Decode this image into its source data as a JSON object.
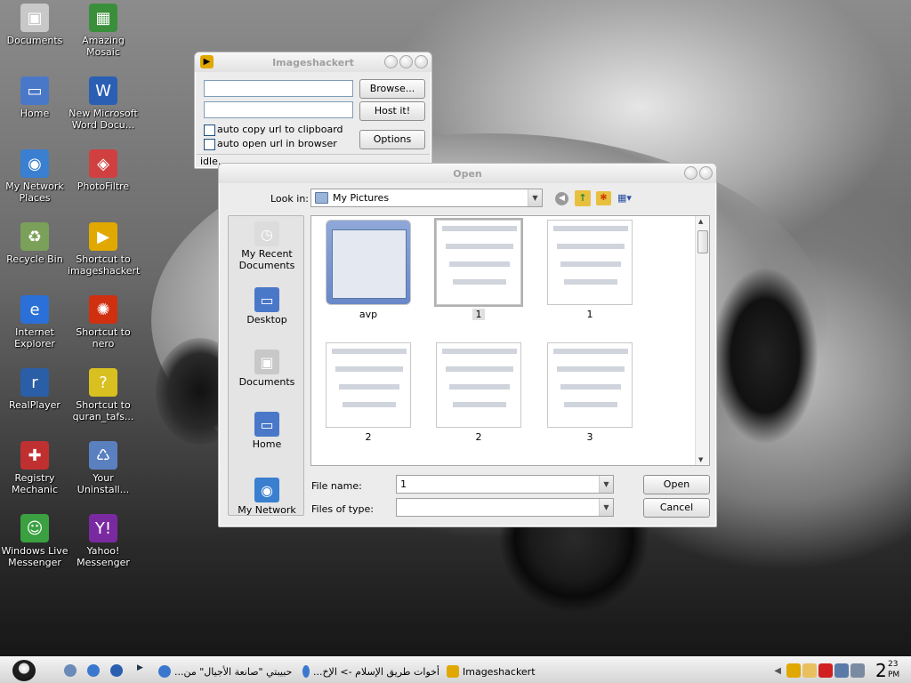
{
  "desktop": {
    "icons": [
      {
        "label": "Documents",
        "icon": "documents-folder-icon",
        "color": "#c8c8c8"
      },
      {
        "label": "Amazing Mosaic",
        "icon": "mosaic-icon",
        "color": "#3a8f3a"
      },
      {
        "label": "Home",
        "icon": "monitor-icon",
        "color": "#4a78c8"
      },
      {
        "label": "New Microsoft Word Docu...",
        "icon": "word-document-icon",
        "color": "#2b5fb4"
      },
      {
        "label": "My Network Places",
        "icon": "network-icon",
        "color": "#3a7fd0"
      },
      {
        "label": "PhotoFiltre",
        "icon": "photofiltre-icon",
        "color": "#d04040"
      },
      {
        "label": "Recycle Bin",
        "icon": "recycle-bin-icon",
        "color": "#7aa05a"
      },
      {
        "label": "Shortcut to imageshackert",
        "icon": "imageshack-icon",
        "color": "#e0a800"
      },
      {
        "label": "Internet Explorer",
        "icon": "internet-explorer-icon",
        "color": "#2a70d8"
      },
      {
        "label": "Shortcut to nero",
        "icon": "nero-icon",
        "color": "#d03010"
      },
      {
        "label": "RealPlayer",
        "icon": "realplayer-icon",
        "color": "#2a5fa8"
      },
      {
        "label": "Shortcut to quran_tafs...",
        "icon": "help-question-icon",
        "color": "#d8c020"
      },
      {
        "label": "Registry Mechanic",
        "icon": "registry-mechanic-icon",
        "color": "#c03030"
      },
      {
        "label": "Your Uninstall...",
        "icon": "uninstall-trash-icon",
        "color": "#5a80c0"
      },
      {
        "label": "Windows Live Messenger",
        "icon": "messenger-icon",
        "color": "#3aa040"
      },
      {
        "label": "Yahoo! Messenger",
        "icon": "yahoo-messenger-icon",
        "color": "#7a2aa0"
      }
    ]
  },
  "imageshack": {
    "title": "Imageshackert",
    "browse_label": "Browse...",
    "host_label": "Host it!",
    "options_label": "Options",
    "auto_copy_label": "auto copy url to clipboard",
    "auto_open_label": "auto open url in browser",
    "status": "idle..."
  },
  "open_dialog": {
    "title": "Open",
    "look_in_label": "Look in:",
    "look_in_value": "My Pictures",
    "places": [
      "My Recent Documents",
      "Desktop",
      "Documents",
      "Home",
      "My Network"
    ],
    "files": [
      {
        "name": "avp",
        "type": "folder"
      },
      {
        "name": "1",
        "type": "image",
        "selected": true
      },
      {
        "name": "1",
        "type": "image"
      },
      {
        "name": "2",
        "type": "image"
      },
      {
        "name": "2",
        "type": "image"
      },
      {
        "name": "3",
        "type": "image"
      }
    ],
    "file_name_label": "File name:",
    "file_name_value": "1",
    "file_type_label": "Files of type:",
    "file_type_value": "",
    "open_label": "Open",
    "cancel_label": "Cancel"
  },
  "taskbar": {
    "tasks": [
      {
        "label": "حبيبتي \"صانعة الأجيال\" من..."
      },
      {
        "label": "أخوات طريق الإسلام -> الإخ..."
      },
      {
        "label": "Imageshackert"
      }
    ],
    "clock_hour": "2",
    "clock_minute": "23",
    "clock_ampm": "PM"
  }
}
